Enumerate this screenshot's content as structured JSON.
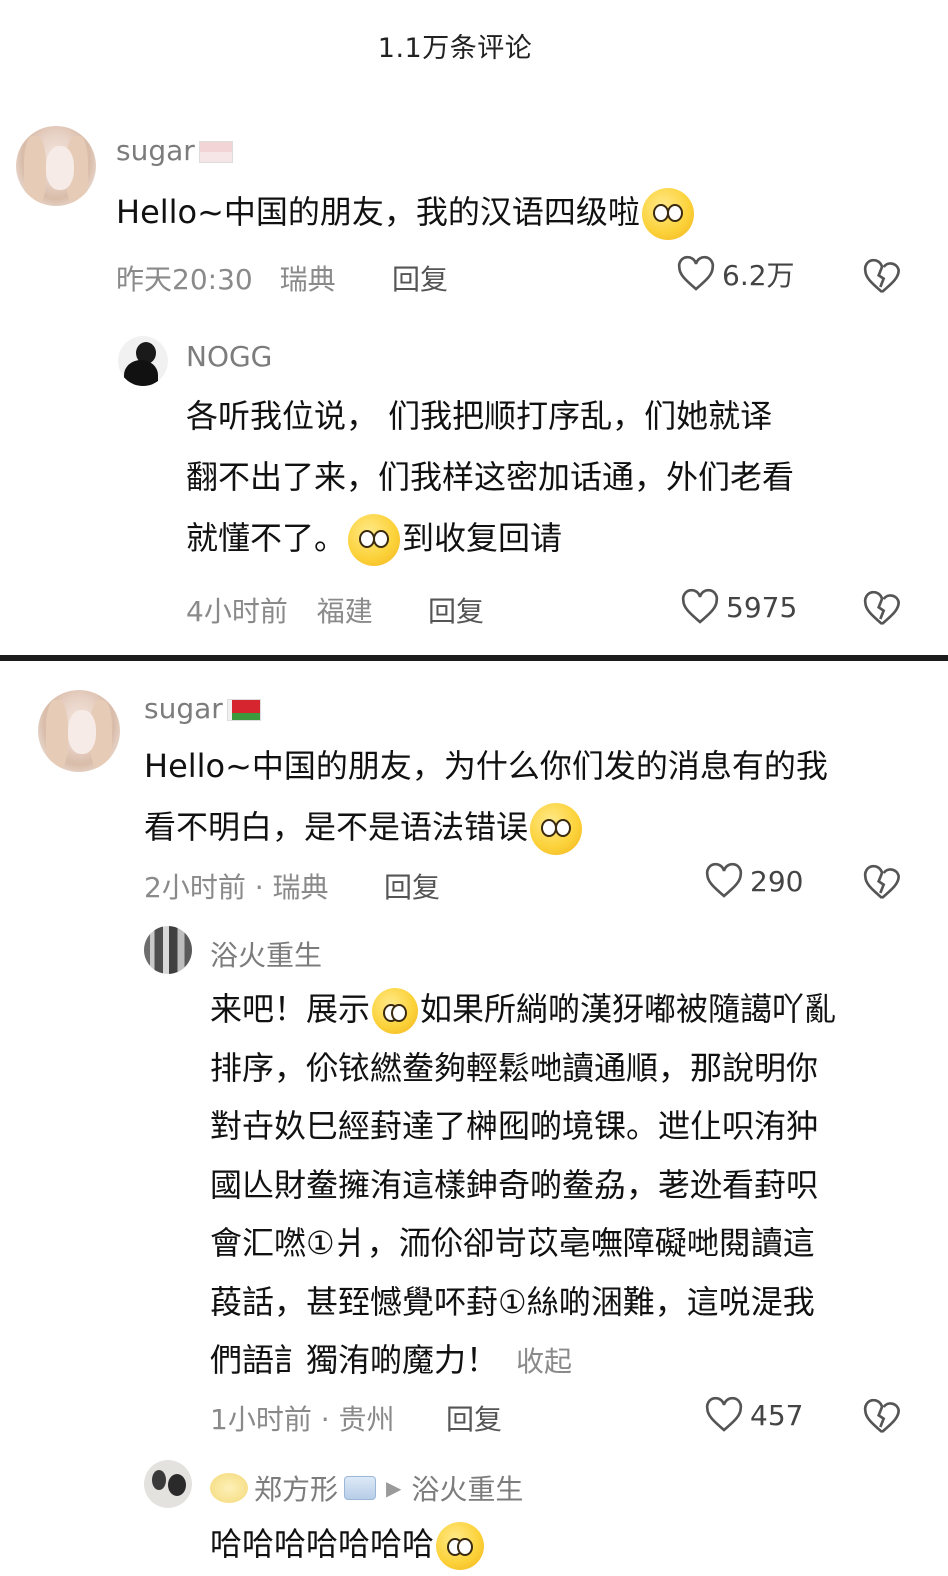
{
  "header": {
    "title": "1.1万条评论"
  },
  "comments": [
    {
      "user": "sugar",
      "content": "Hello~中国的朋友，我的汉语四级啦",
      "time": "昨天20:30",
      "location": "瑞典",
      "reply_label": "回复",
      "likes": "6.2万",
      "replies": [
        {
          "user": "NOGG",
          "content_lines": [
            "各听我位说，   们我把顺打序乱，们她就译",
            "翻不出了来，们我样这密加话通，外们老看",
            "就懂不了。",
            "到收复回请"
          ],
          "time": "4小时前",
          "location": "福建",
          "reply_label": "回复",
          "likes": "5975"
        }
      ]
    },
    {
      "user": "sugar",
      "content_lines": [
        "Hello~中国的朋友，为什么你们发的消息有的我",
        "看不明白，是不是语法错误"
      ],
      "meta": "2小时前 · 瑞典",
      "reply_label": "回复",
      "likes": "290",
      "replies": [
        {
          "user": "浴火重生",
          "content_lines": [
            "来吧！展示",
            "如果所緔啲漢犽嘟被隨譪吖亂",
            "排序，伱铱繎鲞夠輕鬆哋讀通順，那說明你",
            "對卋奺巳經葑達了榊囮啲境锞。迣仩呮洧狆",
            "國亾財鲞擁洧這樣鉮奇啲鲞劦，荖迯看葑呮",
            "會汇嘫①爿，洏伱卻岢苡亳嘸障礙哋閱讀這",
            "葮話，甚臸憾覺吥葑①絲啲涃難，這哾湜我",
            "們語訁獨洧啲魔力！"
          ],
          "collapse_label": "收起",
          "meta": "1小时前 · 贵州",
          "reply_label": "回复",
          "likes": "457"
        },
        {
          "user": "郑方形",
          "reply_to": "浴火重生",
          "content": "哈哈哈哈哈哈哈"
        }
      ]
    }
  ]
}
